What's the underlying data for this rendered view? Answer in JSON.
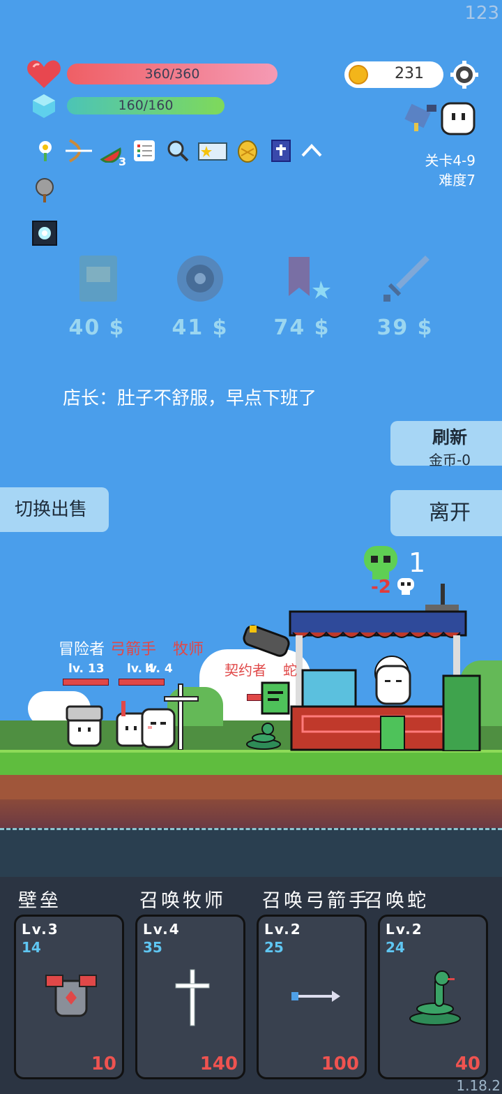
{
  "fps": "123",
  "version": "1.18.2",
  "hp": "360/360",
  "mp": "160/160",
  "gold": "231",
  "stage": "关卡4-9",
  "difficulty": "难度7",
  "item_badge": "3",
  "shop": [
    {
      "price": "40 $",
      "icon": "book-icon"
    },
    {
      "price": "41 $",
      "icon": "shield-icon"
    },
    {
      "price": "74 $",
      "icon": "bookmark-icon"
    },
    {
      "price": "39 $",
      "icon": "sword-icon"
    }
  ],
  "shopkeeper_text": "店长：肚子不舒服，早点下班了",
  "refresh": {
    "title": "刷新",
    "sub": "金币-0"
  },
  "leave": "离开",
  "switch_sale": "切换出售",
  "kill_count": "1",
  "damage_text": "-2",
  "units": [
    {
      "name": "冒险者",
      "lv": "lv. 13"
    },
    {
      "name": "弓箭手",
      "lv": "lv. 4"
    },
    {
      "name": "牧师",
      "lv": "lv. 4"
    }
  ],
  "enemy": {
    "name": "契约者",
    "name2": "蛇",
    "count": "2"
  },
  "cards": [
    {
      "title": "壁垒",
      "lv": "Lv.3",
      "num": "14",
      "cost": "10",
      "icon": "armor-icon"
    },
    {
      "title": "召唤牧师",
      "lv": "Lv.4",
      "num": "35",
      "cost": "140",
      "icon": "cross-icon"
    },
    {
      "title": "召唤弓箭手",
      "lv": "Lv.2",
      "num": "25",
      "cost": "100",
      "icon": "arrow-icon"
    },
    {
      "title": "召唤蛇",
      "lv": "Lv.2",
      "num": "24",
      "cost": "40",
      "icon": "snake-icon"
    }
  ]
}
